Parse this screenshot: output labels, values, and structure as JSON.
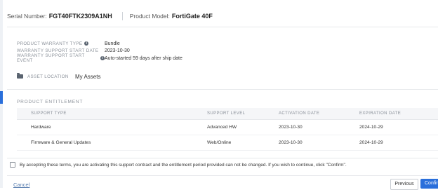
{
  "header": {
    "serial_label": "Serial Number:",
    "serial_value": "FGT40FTK2309A1NH",
    "model_label": "Product Model:",
    "model_value": "FortiGate 40F"
  },
  "info": [
    {
      "key": "PRODUCT WARRANTY TYPE",
      "has_info_icon": true,
      "value": "Bundle"
    },
    {
      "key": "WARRANTY SUPPORT START DATE",
      "has_info_icon": false,
      "value": "2023-10-30"
    },
    {
      "key": "WARRANTY SUPPORT START EVENT",
      "has_info_icon": true,
      "value": "Auto-started 59 days after ship date"
    }
  ],
  "asset": {
    "icon": "folder-icon",
    "label": "ASSET LOCATION",
    "value": "My Assets"
  },
  "entitlement": {
    "title": "PRODUCT ENTITLEMENT",
    "columns": [
      "SUPPORT TYPE",
      "SUPPORT LEVEL",
      "ACTIVATION DATE",
      "EXPIRATION DATE"
    ],
    "rows": [
      [
        "Hardware",
        "Advanced HW",
        "2023-10-30",
        "2024-10-29"
      ],
      [
        "Firmware & General Updates",
        "Web/Online",
        "2023-10-30",
        "2024-10-29"
      ]
    ]
  },
  "terms": "By accepting these terms, you are activating this support contract and the entitlement period provided can not be changed. If you wish to continue, click \"Confirm\".",
  "footer": {
    "cancel": "Cancel",
    "previous": "Previous",
    "confirm": "Confirm"
  },
  "colors": {
    "accent": "#2a6fdb",
    "muted": "#8a9099"
  }
}
